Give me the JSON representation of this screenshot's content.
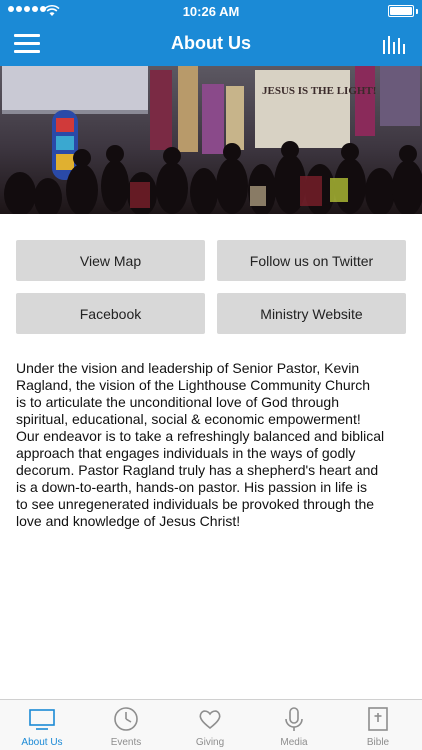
{
  "status_bar": {
    "time": "10:26 AM",
    "signal_icon": "signal-dots-icon",
    "wifi_icon": "wifi-icon",
    "battery_icon": "battery-icon"
  },
  "nav": {
    "title": "About Us",
    "menu_icon": "hamburger-menu-icon",
    "audio_icon": "audio-bars-icon"
  },
  "hero": {
    "banner_text": "JESUS IS THE LIGHT!"
  },
  "buttons": {
    "view_map": "View Map",
    "twitter": "Follow us on Twitter",
    "facebook": "Facebook",
    "ministry_website": "Ministry Website"
  },
  "about": {
    "lines": [
      "Under the vision and leadership of Senior Pastor, Kevin",
      "Ragland, the vision of the Lighthouse Community Church",
      "is to articulate the unconditional love of God through",
      "spiritual, educational, social & economic empowerment!",
      "Our endeavor is to take a refreshingly balanced and biblical",
      "approach that engages individuals in the ways of godly",
      "decorum. Pastor Ragland truly has a shepherd's heart and",
      "is a down-to-earth, hands-on pastor. His passion in life is",
      "to see unregenerated individuals be provoked through the",
      "love and knowledge of Jesus Christ!"
    ]
  },
  "tabs": [
    {
      "label": "About Us",
      "icon": "monitor-icon",
      "active": true
    },
    {
      "label": "Events",
      "icon": "clock-icon",
      "active": false
    },
    {
      "label": "Giving",
      "icon": "heart-icon",
      "active": false
    },
    {
      "label": "Media",
      "icon": "microphone-icon",
      "active": false
    },
    {
      "label": "Bible",
      "icon": "bible-icon",
      "active": false
    }
  ],
  "colors": {
    "brand": "#1b8ad6",
    "button_bg": "#d8d8d8",
    "tab_inactive": "#8e8e8e"
  }
}
